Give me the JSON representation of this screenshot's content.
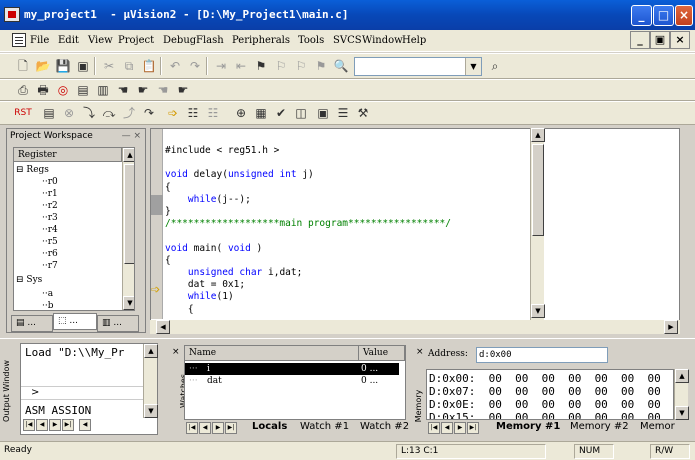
{
  "window": {
    "title": "my_project1  - μVision2 - [D:\\My_Project1\\main.c]",
    "minimize_glyph": "_",
    "maximize_glyph": "□",
    "close_glyph": "×"
  },
  "menu": {
    "items": [
      "File",
      "Edit",
      "View",
      "Project",
      "Debug",
      "Flash",
      "Peripherals",
      "Tools",
      "SVCS",
      "Window",
      "Help"
    ],
    "mdi_min": "_",
    "mdi_restore": "▣",
    "mdi_close": "×"
  },
  "toolbar1": {
    "icons": [
      "new-file-icon",
      "open-folder-icon",
      "save-icon",
      "save-all-icon",
      "cut-icon",
      "copy-icon",
      "paste-icon",
      "undo-icon",
      "redo-icon",
      "indent-icon",
      "unindent-icon",
      "bookmark-icon",
      "bookmark-prev-icon",
      "bookmark-next-icon",
      "bookmark-clear-icon"
    ],
    "find_value": ""
  },
  "project_workspace": {
    "title": "Project Workspace",
    "controls": "— ×",
    "tree_header": "Register",
    "tree": [
      {
        "label": "Regs",
        "level": 0,
        "expander": "⊟"
      },
      {
        "label": "r0",
        "level": 1
      },
      {
        "label": "r1",
        "level": 1
      },
      {
        "label": "r2",
        "level": 1
      },
      {
        "label": "r3",
        "level": 1
      },
      {
        "label": "r4",
        "level": 1
      },
      {
        "label": "r5",
        "level": 1
      },
      {
        "label": "r6",
        "level": 1
      },
      {
        "label": "r7",
        "level": 1
      },
      {
        "label": "Sys",
        "level": 0,
        "expander": "⊟"
      },
      {
        "label": "a",
        "level": 1
      },
      {
        "label": "b",
        "level": 1
      }
    ],
    "tabs": [
      "...",
      "...",
      "..."
    ]
  },
  "editor": {
    "lines": [
      {
        "text": "#include < reg51.h >",
        "kind": "pre"
      },
      {
        "text": "",
        "kind": "plain"
      },
      {
        "text": "void delay(unsigned int j)",
        "kind": "sig"
      },
      {
        "text": "{",
        "kind": "plain"
      },
      {
        "text": "    while(j--);",
        "kind": "while"
      },
      {
        "text": "}",
        "kind": "plain"
      },
      {
        "text": "/*******************main program*****************/",
        "kind": "comment"
      },
      {
        "text": "",
        "kind": "plain"
      },
      {
        "text": "void main( void )",
        "kind": "sig"
      },
      {
        "text": "{",
        "kind": "plain"
      },
      {
        "text": "    unsigned char i,dat;",
        "kind": "decl"
      },
      {
        "text": "    dat = 0x1;",
        "kind": "plain"
      },
      {
        "text": "    while(1)",
        "kind": "while"
      },
      {
        "text": "    {",
        "kind": "plain"
      }
    ]
  },
  "output": {
    "label": "Output Window",
    "line1": "Load \"D:\\\\My_Pr",
    "prompt": ">",
    "line2": "ASM ASSION"
  },
  "locals": {
    "label": "Watches",
    "col_name": "Name",
    "col_value": "Value",
    "rows": [
      {
        "name": "i",
        "value": "0 ...",
        "selected": true
      },
      {
        "name": "dat",
        "value": "0 ...",
        "selected": false
      }
    ],
    "tabs": [
      "Locals",
      "Watch #1",
      "Watch #2"
    ]
  },
  "memory": {
    "label": "Memory",
    "address_label": "Address:",
    "address_value": "d:0x00",
    "rows": [
      "D:0x00:  00  00  00  00  00  00  00",
      "D:0x07:  00  00  00  00  00  00  00",
      "D:0x0E:  00  00  00  00  00  00  00",
      "D:0x15:  00  00  00  00  00  00  00"
    ],
    "tabs": [
      "Memory #1",
      "Memory #2",
      "Memor"
    ]
  },
  "status": {
    "ready": "Ready",
    "position": "L:13 C:1",
    "num": "NUM",
    "rw": "R/W"
  }
}
